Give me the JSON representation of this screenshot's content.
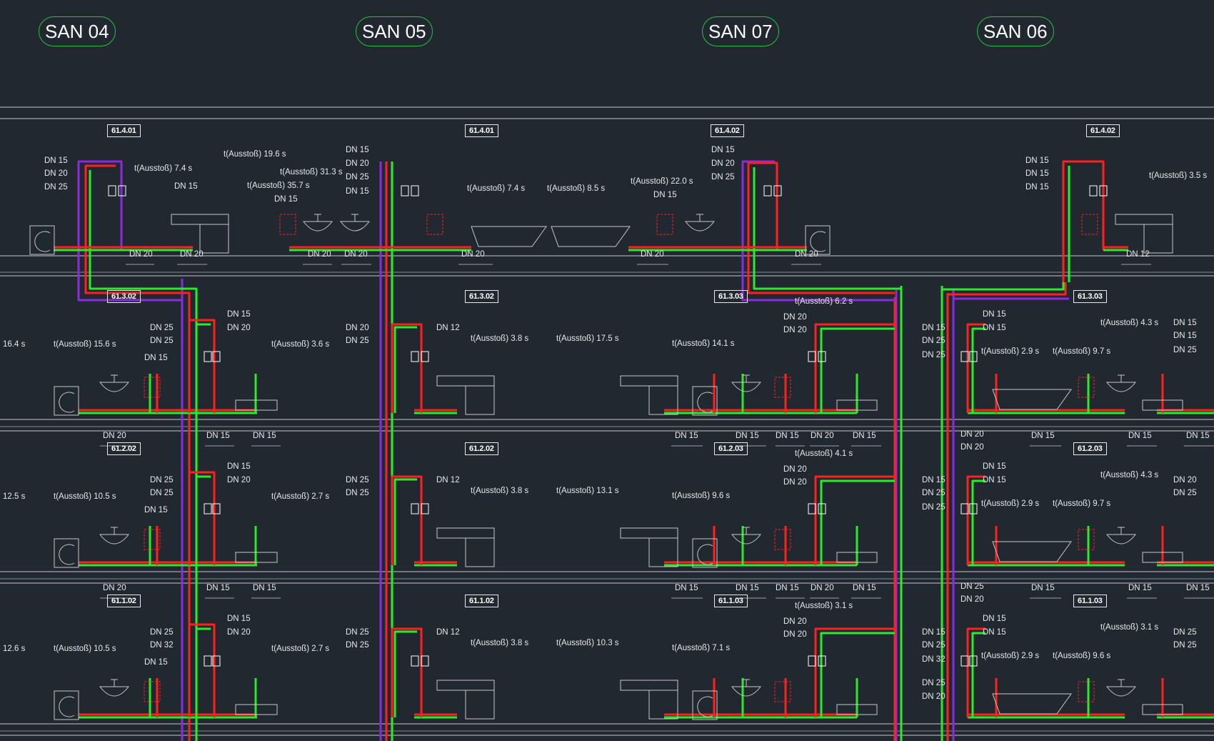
{
  "risers": [
    {
      "id": "san04",
      "label": "SAN 04"
    },
    {
      "id": "san05",
      "label": "SAN 05"
    },
    {
      "id": "san07",
      "label": "SAN 07"
    },
    {
      "id": "san06",
      "label": "SAN 06"
    }
  ],
  "room_tags": [
    "61.4.01",
    "61.4.01",
    "61.4.02",
    "61.4.02",
    "61.3.02",
    "61.3.02",
    "61.3.03",
    "61.3.03",
    "61.2.02",
    "61.2.02",
    "61.2.03",
    "61.2.03",
    "61.1.02",
    "61.1.02",
    "61.1.03",
    "61.1.03"
  ],
  "labels": [
    "DN 15",
    "DN 20",
    "DN 25",
    "t(Ausstoß) 7.4 s",
    "t(Ausstoß) 19.6 s",
    "DN 15",
    "DN 20",
    "DN 20",
    "DN 15",
    "DN 20",
    "DN 25",
    "DN 15",
    "t(Ausstoß) 31.3 s",
    "t(Ausstoß) 35.7 s",
    "DN 15",
    "DN 20",
    "DN 20",
    "DN 20",
    "t(Ausstoß) 7.4 s",
    "t(Ausstoß) 8.5 s",
    "t(Ausstoß) 22.0 s",
    "DN 15",
    "DN 15",
    "DN 20",
    "DN 25",
    "DN 20",
    "DN 20",
    "DN 15",
    "DN 15",
    "DN 15",
    "t(Ausstoß) 3.5 s",
    "DN 12",
    "16.4 s",
    "t(Ausstoß) 15.6 s",
    "DN 15",
    "DN 25",
    "DN 25",
    "DN 15",
    "DN 20",
    "t(Ausstoß) 3.6 s",
    "DN 20",
    "DN 15",
    "DN 15",
    "DN 20",
    "DN 25",
    "DN 12",
    "t(Ausstoß) 3.8 s",
    "t(Ausstoß) 17.5 s",
    "t(Ausstoß) 14.1 s",
    "t(Ausstoß) 6.2 s",
    "DN 20",
    "DN 20",
    "DN 15",
    "DN 25",
    "DN 25",
    "DN 15",
    "DN 15",
    "DN 15",
    "DN 20",
    "DN 15",
    "DN 15",
    "DN 15",
    "t(Ausstoß) 2.9 s",
    "t(Ausstoß) 9.7 s",
    "t(Ausstoß) 4.3 s",
    "DN 15",
    "DN 15",
    "DN 25",
    "DN 20",
    "DN 20",
    "DN 15",
    "DN 15",
    "DN 15",
    "12.5 s",
    "t(Ausstoß) 10.5 s",
    "DN 15",
    "DN 25",
    "DN 25",
    "DN 15",
    "DN 20",
    "t(Ausstoß) 2.7 s",
    "DN 20",
    "DN 15",
    "DN 15",
    "DN 25",
    "DN 25",
    "DN 12",
    "t(Ausstoß) 3.8 s",
    "t(Ausstoß) 13.1 s",
    "t(Ausstoß) 9.6 s",
    "t(Ausstoß) 4.1 s",
    "DN 20",
    "DN 20",
    "DN 15",
    "DN 25",
    "DN 25",
    "DN 15",
    "DN 15",
    "DN 15",
    "DN 20",
    "DN 15",
    "DN 15",
    "DN 15",
    "t(Ausstoß) 2.9 s",
    "t(Ausstoß) 9.7 s",
    "t(Ausstoß) 4.3 s",
    "DN 20",
    "DN 25",
    "DN 25",
    "DN 20",
    "DN 15",
    "DN 15",
    "DN 15",
    "12.6 s",
    "t(Ausstoß) 10.5 s",
    "DN 15",
    "DN 25",
    "DN 32",
    "DN 15",
    "DN 20",
    "t(Ausstoß) 2.7 s",
    "DN 25",
    "DN 25",
    "DN 12",
    "t(Ausstoß) 3.8 s",
    "t(Ausstoß) 10.3 s",
    "t(Ausstoß) 7.1 s",
    "t(Ausstoß) 3.1 s",
    "DN 20",
    "DN 20",
    "DN 15",
    "DN 25",
    "DN 32",
    "DN 25",
    "DN 20",
    "DN 15",
    "DN 15",
    "t(Ausstoß) 2.9 s",
    "t(Ausstoß) 9.6 s",
    "t(Ausstoß) 3.1 s",
    "DN 25",
    "DN 25"
  ]
}
